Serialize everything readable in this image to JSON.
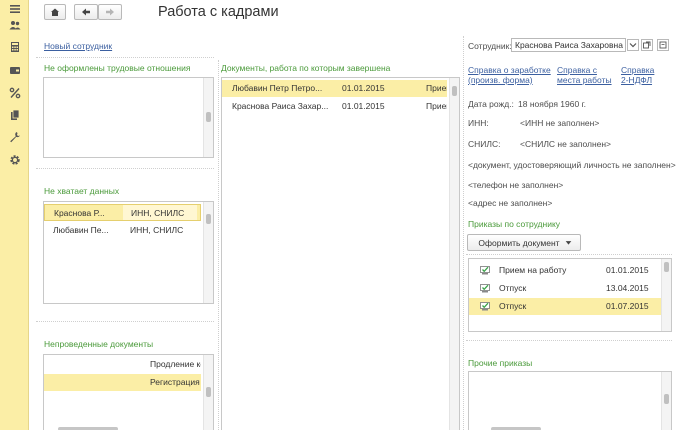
{
  "window": {
    "title": "Работа с кадрами"
  },
  "sidebar": {
    "icons": [
      "menu-icon",
      "people-icon",
      "calculator-icon",
      "wallet-icon",
      "percent-icon",
      "documents-icon",
      "wrench-icon",
      "gear-icon"
    ]
  },
  "toolbar": {
    "home_icon": "home-icon",
    "back_icon": "arrow-left-icon",
    "forward_icon": "arrow-right-icon"
  },
  "left": {
    "new_employee_link": "Новый сотрудник",
    "no_labor_title": "Не оформлены трудовые отношения",
    "missing_data_title": "Не хватает данных",
    "missing_data_rows": [
      {
        "name": "Краснова Р...",
        "issue": "ИНН, СНИЛС",
        "selected": true
      },
      {
        "name": "Любавин Пе...",
        "issue": "ИНН, СНИЛС",
        "selected": false
      }
    ],
    "unposted_title": "Непроведенные документы",
    "unposted_rows": [
      {
        "text": "Продление ко",
        "selected": false
      },
      {
        "text": "Регистрация г",
        "selected": true
      }
    ]
  },
  "middle": {
    "title": "Документы, работа по которым завершена",
    "rows": [
      {
        "name": "Любавин Петр Петро...",
        "date": "01.01.2015",
        "type": "Прием",
        "selected": true
      },
      {
        "name": "Краснова Раиса Захар...",
        "date": "01.01.2015",
        "type": "Прием",
        "selected": false
      }
    ]
  },
  "right": {
    "employee_label": "Сотрудник:",
    "employee_value": "Краснова Раиса Захаровна",
    "links": {
      "salary_1": "Справка о заработке",
      "salary_2": "(произв. форма)",
      "work_1": "Справка с",
      "work_2": "места работы",
      "ndfl_1": "Справка",
      "ndfl_2": "2-НДФЛ"
    },
    "birth_label": "Дата рожд.:",
    "birth_value": "18 ноября 1960 г.",
    "inn_label": "ИНН:",
    "inn_value": "<ИНН не заполнен>",
    "snils_label": "СНИЛС:",
    "snils_value": "<СНИЛС не заполнен>",
    "doc_missing": "<документ, удостоверяющий личность не заполнен>",
    "phone_missing": "<телефон не заполнен>",
    "address_missing": "<адрес не заполнен>",
    "orders_title": "Приказы по сотруднику",
    "make_doc_button": "Оформить документ",
    "orders": [
      {
        "name": "Прием на работу",
        "date": "01.01.2015",
        "selected": false
      },
      {
        "name": "Отпуск",
        "date": "13.04.2015",
        "selected": false
      },
      {
        "name": "Отпуск",
        "date": "01.07.2015",
        "selected": true
      }
    ],
    "other_orders_title": "Прочие приказы"
  }
}
